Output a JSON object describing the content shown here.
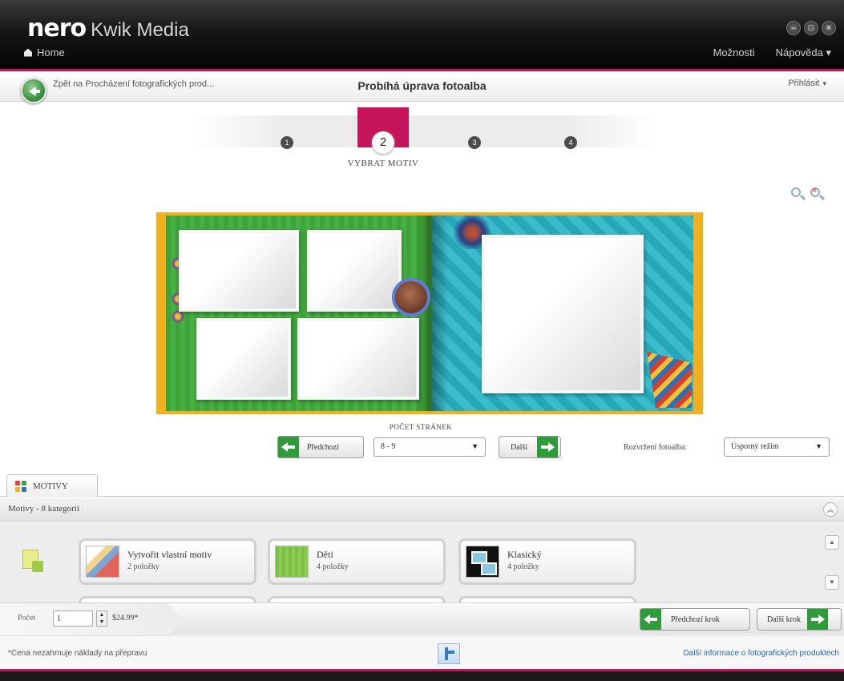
{
  "window": {
    "brand_logo": "nero",
    "app_name": "Kwik Media",
    "home_label": "Home",
    "menu": [
      "Možnosti",
      "Nápověda ▾"
    ],
    "controls": [
      "minimize-icon",
      "maximize-icon",
      "close-icon"
    ]
  },
  "breadcrumb": {
    "back_text": "Zpět na Procházení fotografických prod...",
    "page_title": "Probíhá úprava fotoalba",
    "signin_label": "Přihlásit"
  },
  "wizard": {
    "steps": [
      "1",
      "2",
      "3",
      "4"
    ],
    "active_step": 2,
    "active_label": "VYBRAT MOTIV"
  },
  "album": {
    "left_page_photo_slots": 4,
    "right_page_photo_slots": 1
  },
  "page_controls": {
    "page_count_label": "POČET STRÁNEK",
    "prev_label": "Předchozí",
    "next_label": "Další",
    "page_select_value": "8 - 9",
    "layout_label": "Rozvržení fotoalba:",
    "layout_select_value": "Úsporný režim"
  },
  "motifs": {
    "tab_label": "MOTIVY",
    "category_label": "Motivy - 8 kategorií",
    "cards": [
      {
        "name": "Vytvořit vlastní motiv",
        "count": "2 položky"
      },
      {
        "name": "Děti",
        "count": "4 položky"
      },
      {
        "name": "Klasický",
        "count": "4 položky"
      }
    ]
  },
  "order": {
    "qty_label": "Počet",
    "qty_value": "1",
    "price": "$24.99*",
    "prev_step_label": "Předchozí krok",
    "next_step_label": "Další krok"
  },
  "footer": {
    "note": "*Cena nezahrnuje náklady na přepravu",
    "info_link": "Další informace o fotografických produktech"
  },
  "colors": {
    "accent_pink": "#c6145b",
    "nav_green": "#2f9b3b",
    "album_border": "#f2b01e",
    "left_page": "#3ea33a",
    "right_page": "#27a7b8",
    "link_blue": "#2a62b8"
  }
}
